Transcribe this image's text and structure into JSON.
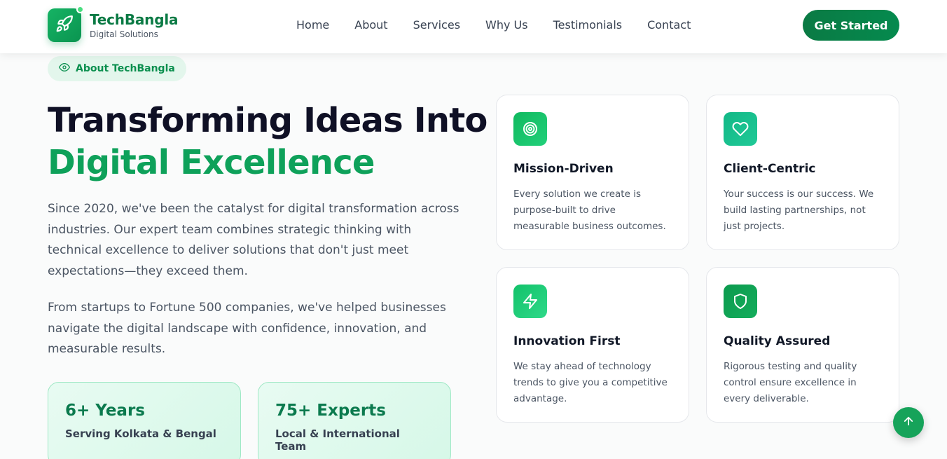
{
  "brand": {
    "name": "TechBangla",
    "tagline": "Digital Solutions",
    "logo_icon": "rocket-icon"
  },
  "nav": {
    "items": [
      "Home",
      "About",
      "Services",
      "Why Us",
      "Testimonials",
      "Contact"
    ],
    "cta": "Get Started"
  },
  "about": {
    "badge": "About TechBangla",
    "badge_icon": "eye-icon",
    "heading_line1": "Transforming Ideas Into",
    "heading_line2": "Digital Excellence",
    "paragraph1": "Since 2020, we've been the catalyst for digital transformation across industries. Our expert team combines strategic thinking with technical excellence to deliver solutions that don't just meet expectations—they exceed them.",
    "paragraph2": "From startups to Fortune 500 companies, we've helped businesses navigate the digital landscape with confidence, innovation, and measurable results.",
    "stats": [
      {
        "value": "6+ Years",
        "label": "Serving Kolkata & Bengal"
      },
      {
        "value": "75+ Experts",
        "label": "Local & International Team"
      }
    ]
  },
  "cards": [
    {
      "icon": "target-icon",
      "title": "Mission-Driven",
      "text": "Every solution we create is purpose-built to drive measurable business outcomes."
    },
    {
      "icon": "heart-icon",
      "title": "Client-Centric",
      "text": "Your success is our success. We build lasting partnerships, not just projects."
    },
    {
      "icon": "lightning-icon",
      "title": "Innovation First",
      "text": "We stay ahead of technology trends to give you a competitive advantage."
    },
    {
      "icon": "shield-icon",
      "title": "Quality Assured",
      "text": "Rigorous testing and quality control ensure excellence in every deliverable."
    }
  ],
  "colors": {
    "brand_green": "#0a7a44",
    "accent_green": "#0ea15a",
    "heading_dark": "#0f1025"
  },
  "scroll_top_icon": "arrow-up-icon"
}
